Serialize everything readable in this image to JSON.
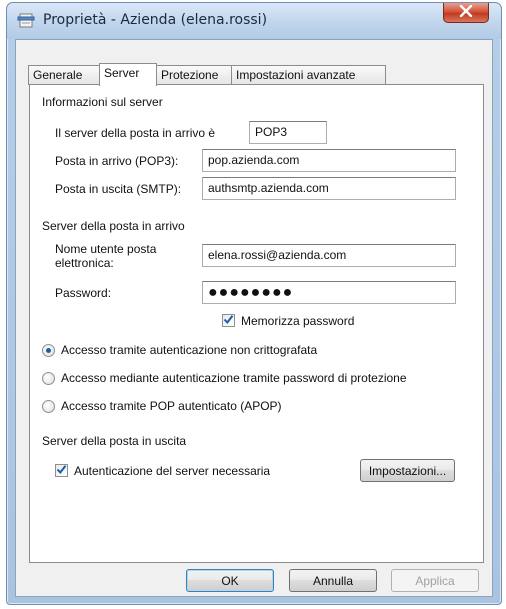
{
  "window": {
    "title": "Proprietà - Azienda (elena.rossi)"
  },
  "tabs": [
    "Generale",
    "Server",
    "Protezione",
    "Impostazioni avanzate"
  ],
  "server_info": {
    "group_label": "Informazioni sul server",
    "incoming_type_label": "Il server della posta in arrivo è",
    "incoming_type_value": "POP3",
    "incoming_label": "Posta in arrivo (POP3):",
    "incoming_value": "pop.azienda.com",
    "outgoing_label": "Posta in uscita (SMTP):",
    "outgoing_value": "authsmtp.azienda.com"
  },
  "incoming_server": {
    "group_label": "Server della posta in arrivo",
    "username_label_line1": "Nome utente posta",
    "username_label_line2": "elettronica:",
    "username_value": "elena.rossi@azienda.com",
    "password_label": "Password:",
    "password_value": "●●●●●●●●",
    "remember_label": "Memorizza password",
    "remember_checked": true
  },
  "auth_options": [
    {
      "label": "Accesso tramite autenticazione non crittografata",
      "selected": true
    },
    {
      "label": "Accesso mediante autenticazione tramite password di protezione",
      "selected": false
    },
    {
      "label": "Accesso tramite POP autenticato (APOP)",
      "selected": false
    }
  ],
  "outgoing_server": {
    "group_label": "Server della posta in uscita",
    "auth_required_label": "Autenticazione del server necessaria",
    "auth_required_checked": true,
    "settings_button": "Impostazioni..."
  },
  "buttons": {
    "ok": "OK",
    "cancel": "Annulla",
    "apply": "Applica"
  },
  "colors": {
    "radio_dot": "#1d5da8",
    "check_mark": "#1d5da8",
    "close_button": "#c23a20"
  }
}
